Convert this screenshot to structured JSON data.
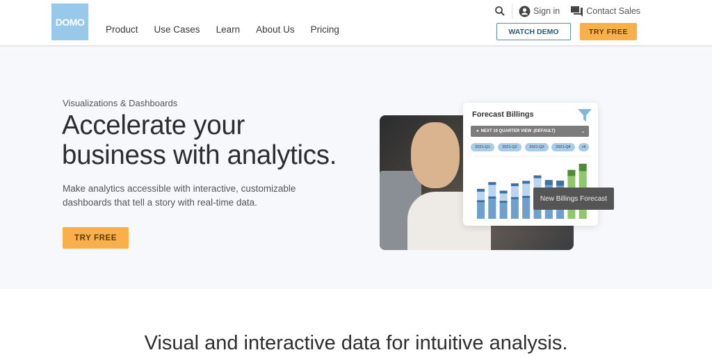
{
  "header": {
    "logo": "DOMO",
    "nav": [
      "Product",
      "Use Cases",
      "Learn",
      "About Us",
      "Pricing"
    ],
    "sign_in": "Sign in",
    "contact_sales": "Contact Sales",
    "watch_demo": "WATCH DEMO",
    "try_free": "TRY FREE"
  },
  "hero": {
    "eyebrow": "Visualizations & Dashboards",
    "title_line1": "Accelerate your",
    "title_line2": "business with analytics.",
    "subtitle_line1": "Make analytics accessible with interactive, customizable",
    "subtitle_line2": "dashboards that tell a story with real-time data.",
    "cta": "TRY FREE"
  },
  "forecast_card": {
    "title": "Forecast Billings",
    "view_select": "NEXT 10 QUARTER VIEW",
    "view_default": "(DEFAULT)",
    "chips": [
      "2021-Q1",
      "2021-Q2",
      "2021-Q3",
      "2021-Q4",
      "+6"
    ],
    "tooltip": "New Billings Forecast",
    "bars": [
      {
        "total": 49,
        "base": 27,
        "kind": "actual"
      },
      {
        "total": 60,
        "base": 33,
        "kind": "actual"
      },
      {
        "total": 46,
        "base": 26,
        "kind": "actual"
      },
      {
        "total": 58,
        "base": 32,
        "kind": "actual"
      },
      {
        "total": 62,
        "base": 34,
        "kind": "actual"
      },
      {
        "total": 71,
        "base": 40,
        "kind": "actual"
      },
      {
        "total": 60,
        "base": 60,
        "kind": "actual"
      },
      {
        "total": 59,
        "base": 59,
        "kind": "actual"
      },
      {
        "total": 80,
        "base": 70,
        "kind": "forecast"
      },
      {
        "total": 90,
        "base": 78,
        "kind": "forecast"
      }
    ],
    "colors": {
      "actual_base": "#6f9fcc",
      "actual_band": "#3f6d9e",
      "actual_top": "#b9d5ef",
      "forecast_base": "#8fc86a",
      "forecast_top": "#4f8a35",
      "accent": "#f9b04a"
    }
  },
  "section2": {
    "title": "Visual and interactive data for intuitive analysis."
  }
}
